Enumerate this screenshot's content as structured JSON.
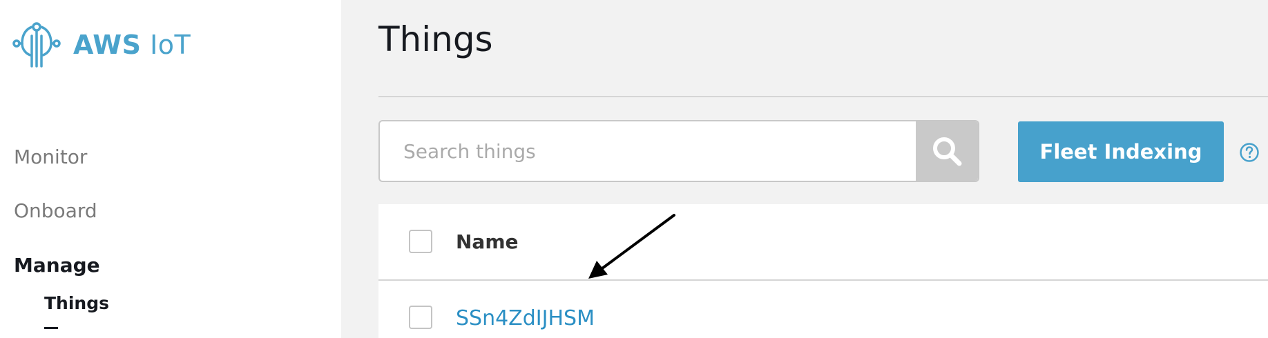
{
  "brand": {
    "bold": "AWS",
    "rest": " IoT"
  },
  "nav": {
    "items": [
      {
        "label": "Monitor"
      },
      {
        "label": "Onboard"
      },
      {
        "label": "Manage"
      }
    ],
    "sub_items": [
      {
        "label": "Things"
      }
    ]
  },
  "page": {
    "title": "Things"
  },
  "search": {
    "placeholder": "Search things"
  },
  "fleet": {
    "label": "Fleet Indexing"
  },
  "table": {
    "columns": [
      "Name"
    ],
    "rows": [
      {
        "name": "SSn4ZdIJHSM"
      }
    ]
  },
  "colors": {
    "accent": "#47a1cc",
    "link": "#2b8fc4",
    "text_dark": "#16191f"
  },
  "icons": {
    "logo": "aws-iot-logo-icon",
    "search": "search-icon",
    "help": "help-icon",
    "arrow": "annotation-arrow-icon"
  }
}
